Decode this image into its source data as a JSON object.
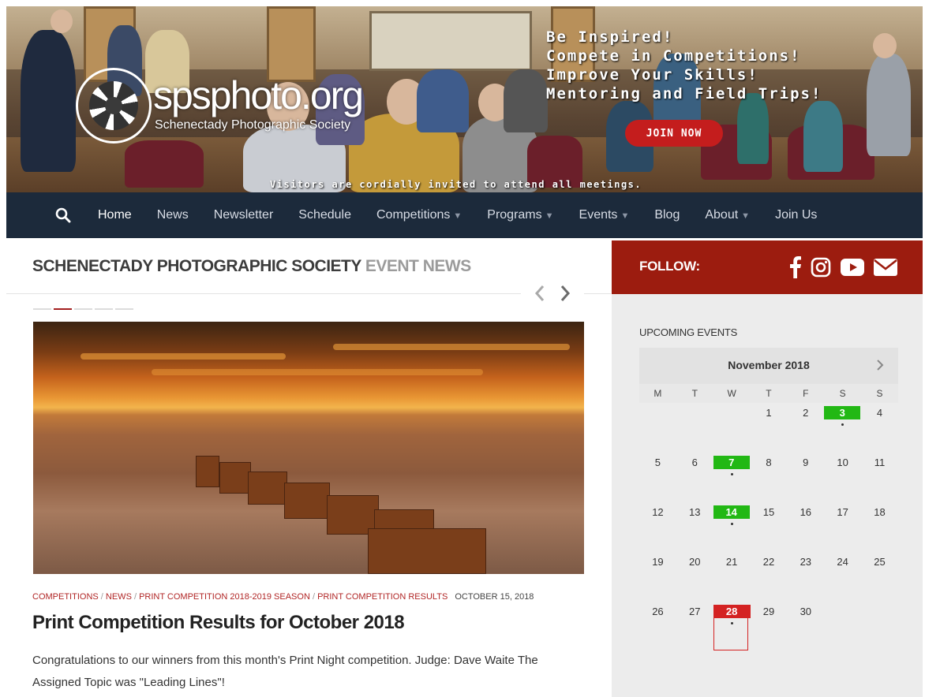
{
  "hero": {
    "logo_text": "spsphoto.org",
    "logo_subtitle": "Schenectady Photographic Society",
    "ring_text": "Schenectady Photographic Society",
    "taglines": [
      "Be Inspired!",
      "Compete in Competitions!",
      "Improve Your Skills!",
      "Mentoring and Field Trips!"
    ],
    "join_label": "JOIN NOW",
    "visitors_text": "Visitors are cordially invited to attend all meetings."
  },
  "nav": {
    "items": [
      {
        "label": "Home",
        "dropdown": false
      },
      {
        "label": "News",
        "dropdown": false
      },
      {
        "label": "Newsletter",
        "dropdown": false
      },
      {
        "label": "Schedule",
        "dropdown": false
      },
      {
        "label": "Competitions",
        "dropdown": true
      },
      {
        "label": "Programs",
        "dropdown": true
      },
      {
        "label": "Events",
        "dropdown": true
      },
      {
        "label": "Blog",
        "dropdown": false
      },
      {
        "label": "About",
        "dropdown": true
      },
      {
        "label": "Join Us",
        "dropdown": false
      }
    ],
    "active": "Home"
  },
  "main": {
    "section_title": "SCHENECTADY PHOTOGRAPHIC SOCIETY",
    "section_title_light": "EVENT NEWS",
    "slider_pages": 5,
    "slider_active": 2,
    "post": {
      "categories": [
        "COMPETITIONS",
        "NEWS",
        "PRINT COMPETITION 2018-2019 SEASON",
        "PRINT COMPETITION RESULTS"
      ],
      "date": "OCTOBER 15, 2018",
      "title": "Print Competition Results for October 2018",
      "excerpt": "Congratulations to our winners from this month's Print Night competition. Judge: Dave Waite   The Assigned Topic was \"Leading Lines\"!"
    }
  },
  "sidebar": {
    "follow_label": "FOLLOW:",
    "social": [
      "facebook-icon",
      "instagram-icon",
      "youtube-icon",
      "email-icon"
    ],
    "upcoming_label": "UPCOMING EVENTS",
    "calendar": {
      "month": "November 2018",
      "weekdays": [
        "M",
        "T",
        "W",
        "T",
        "F",
        "S",
        "S"
      ],
      "weeks": [
        [
          "",
          "",
          "",
          "1",
          "2",
          "3",
          "4"
        ],
        [
          "5",
          "6",
          "7",
          "8",
          "9",
          "10",
          "11"
        ],
        [
          "12",
          "13",
          "14",
          "15",
          "16",
          "17",
          "18"
        ],
        [
          "19",
          "20",
          "21",
          "22",
          "23",
          "24",
          "25"
        ],
        [
          "26",
          "27",
          "28",
          "29",
          "30",
          "",
          ""
        ]
      ],
      "event_days": [
        "3",
        "7",
        "14"
      ],
      "today": "28",
      "event_color": "#22b814",
      "today_color": "#d42222"
    }
  },
  "colors": {
    "nav_bg": "#1c2a3b",
    "accent_red": "#9c1c0f",
    "link_red": "#b12626",
    "sidebar_bg": "#ececec"
  }
}
